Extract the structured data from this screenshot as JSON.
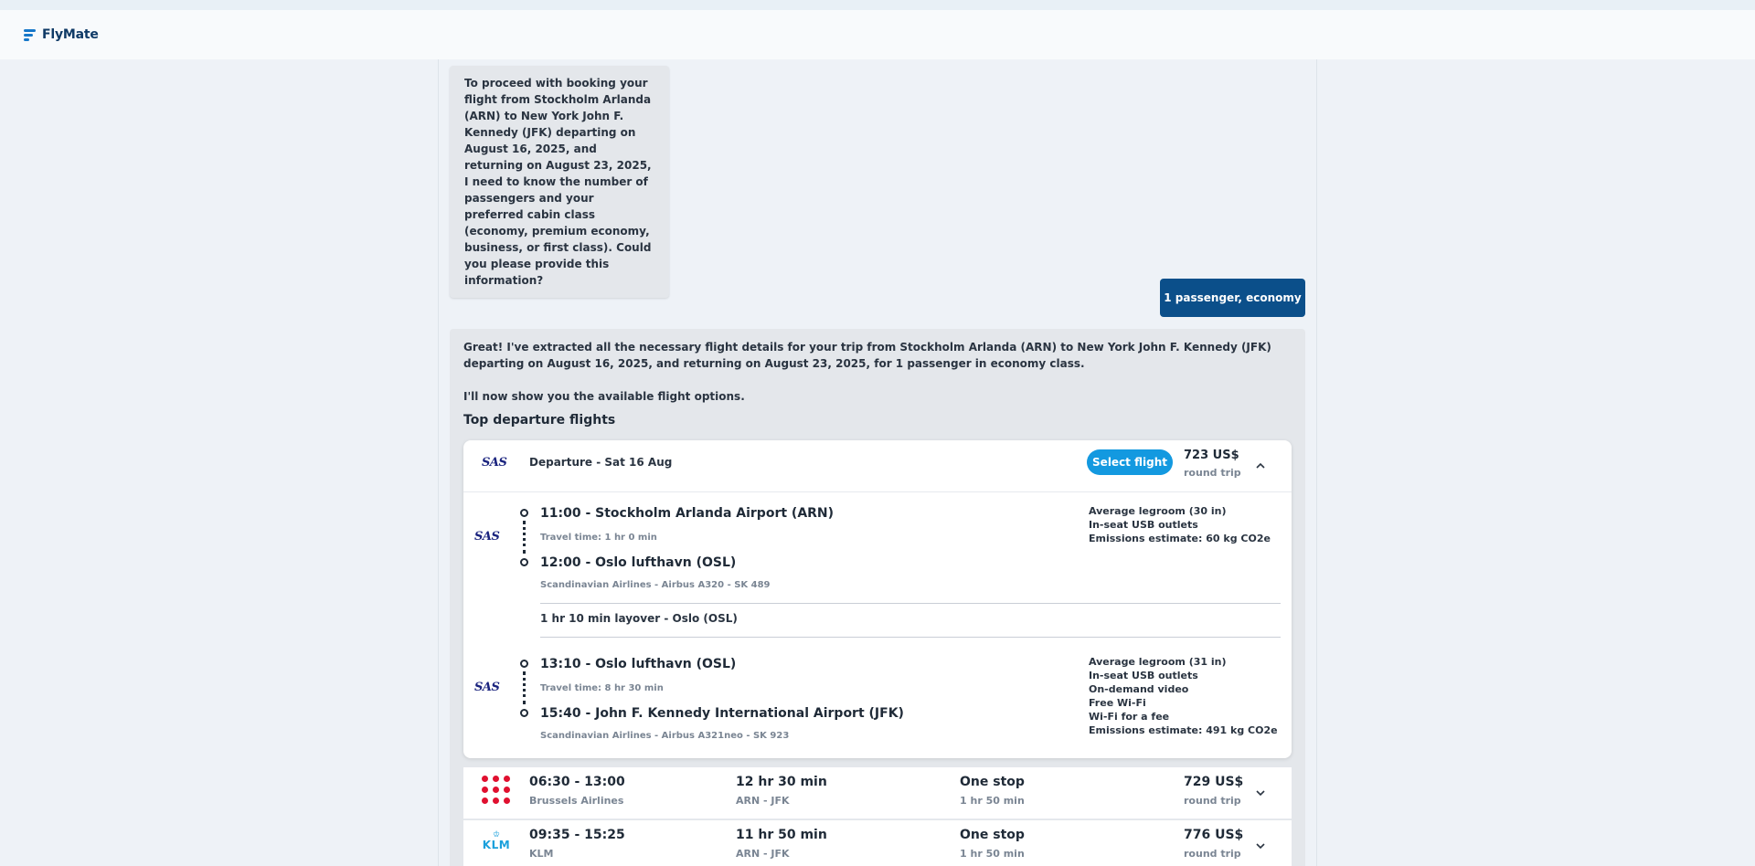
{
  "app": {
    "name": "FlyMate",
    "logo_icon": "flymate-logo-icon"
  },
  "messages": {
    "bot_question": "To proceed with booking your flight from Stockholm Arlanda (ARN) to New York John F. Kennedy (JFK) departing on August 16, 2025, and returning on August 23, 2025, I need to know the number of passengers and your preferred cabin class (economy, premium economy, business, or first class). Could you please provide this information?",
    "user_reply": "1 passenger, economy",
    "bot_summary_1": "Great! I've extracted all the necessary flight details for your trip from Stockholm Arlanda (ARN) to New York John F. Kennedy (JFK) departing on August 16, 2025, and returning on August 23, 2025, for 1 passenger in economy class.",
    "bot_summary_2": "I'll now show you the available flight options.",
    "section_title": "Top departure flights"
  },
  "expanded_flight": {
    "airline_logo": "SAS",
    "header_title": "Departure - Sat 16 Aug",
    "select_label": "Select flight",
    "price": "723 US$",
    "price_sub": "round trip",
    "leg1": {
      "logo": "SAS",
      "dep": "11:00 - Stockholm Arlanda Airport (ARN)",
      "travel_time": "Travel time: 1 hr 0 min",
      "arr": "12:00 - Oslo lufthavn (OSL)",
      "details": "Scandinavian Airlines - Airbus A320 - SK 489",
      "amenities": [
        "Average legroom (30 in)",
        "In-seat USB outlets",
        "Emissions estimate: 60 kg CO2e"
      ]
    },
    "layover": "1 hr 10 min layover - Oslo (OSL)",
    "leg2": {
      "logo": "SAS",
      "dep": "13:10 - Oslo lufthavn (OSL)",
      "travel_time": "Travel time: 8 hr 30 min",
      "arr": "15:40 - John F. Kennedy International Airport (JFK)",
      "details": "Scandinavian Airlines - Airbus A321neo - SK 923",
      "amenities": [
        "Average legroom (31 in)",
        "In-seat USB outlets",
        "On-demand video",
        "Free Wi-Fi",
        "Wi-Fi for a fee",
        "Emissions estimate: 491 kg CO2e"
      ]
    }
  },
  "flights": [
    {
      "logo": "brussels-airlines-logo",
      "times": "06:30 - 13:00",
      "airline": "Brussels Airlines",
      "duration": "12 hr 30 min",
      "route": "ARN - JFK",
      "stops": "One stop",
      "layover": "1 hr 50 min",
      "price": "729 US$",
      "price_sub": "round trip"
    },
    {
      "logo": "klm-logo",
      "logo_text": "KLM",
      "times": "09:35 - 15:25",
      "airline": "KLM",
      "duration": "11 hr 50 min",
      "route": "ARN - JFK",
      "stops": "One stop",
      "layover": "1 hr 50 min",
      "price": "776 US$",
      "price_sub": "round trip"
    }
  ],
  "colors": {
    "primary_dark": "#0b4f8a",
    "select_button": "#1399e0",
    "sas_blue": "#1a237e",
    "brussels_red": "#e0102f",
    "klm_blue": "#1aa0dc"
  }
}
